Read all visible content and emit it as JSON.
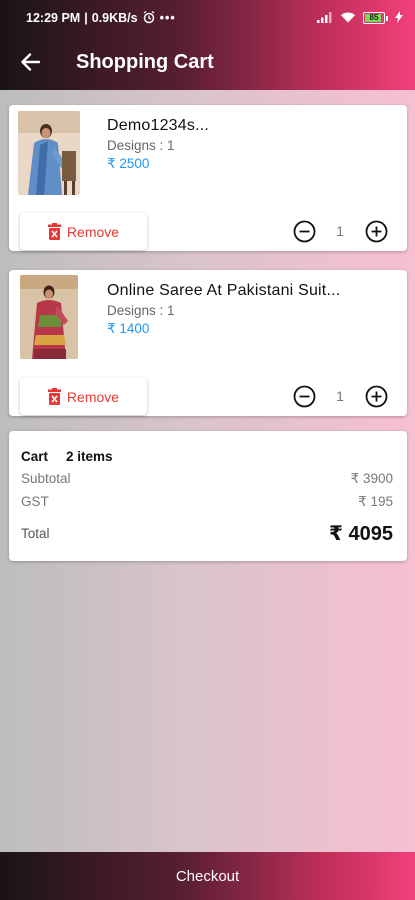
{
  "status_bar": {
    "time": "12:29 PM",
    "speed": "0.9KB/s",
    "battery": "85"
  },
  "header": {
    "title": "Shopping Cart"
  },
  "cart_items": [
    {
      "name": "Demo1234s...",
      "designs": "Designs : 1",
      "price": "₹ 2500",
      "remove_label": "Remove",
      "quantity": "1"
    },
    {
      "name": "Online Saree At Pakistani Suit...",
      "designs": "Designs : 1",
      "price": "₹ 1400",
      "remove_label": "Remove",
      "quantity": "1"
    }
  ],
  "summary": {
    "cart_label": "Cart",
    "item_count": "2 items",
    "subtotal_label": "Subtotal",
    "subtotal_value": "₹ 3900",
    "gst_label": "GST",
    "gst_value": "₹ 195",
    "total_label": "Total",
    "total_value": "₹ 4095"
  },
  "checkout_label": "Checkout",
  "colors": {
    "accent": "#f2407a",
    "price": "#2196f3",
    "remove": "#e53935"
  }
}
